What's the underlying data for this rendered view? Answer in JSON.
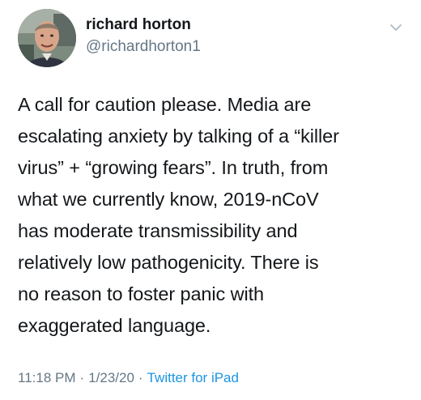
{
  "tweet": {
    "author": {
      "display_name": "richard horton",
      "handle": "@richardhorton1"
    },
    "text": "A call for caution please. Media are\nescalating anxiety by talking of a “killer\nvirus” + “growing fears”. In truth, from\nwhat we currently know, 2019-nCoV\nhas moderate transmissibility and\nrelatively low pathogenicity. There is\nno reason to foster panic with\nexaggerated language.",
    "time": "11:18 PM",
    "date": "1/23/20",
    "separator": "·",
    "source": "Twitter for iPad"
  },
  "icons": {
    "menu": "chevron-down-icon",
    "avatar": "profile-photo"
  },
  "colors": {
    "text_primary": "#14171a",
    "text_secondary": "#657786",
    "link": "#1b95e0"
  }
}
